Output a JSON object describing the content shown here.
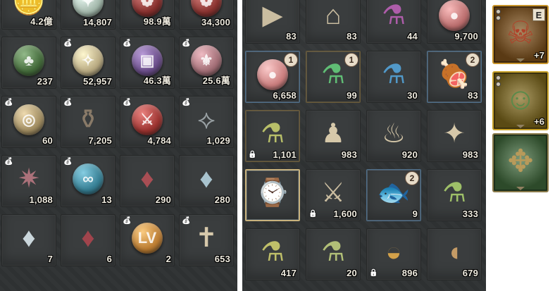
{
  "left_grid": {
    "items": [
      {
        "qty": "4.2億",
        "icon": "gold-coins-icon",
        "glyph": "🪙",
        "bag": true
      },
      {
        "qty": "14,807",
        "icon": "silver-seal-icon",
        "glyph": "✦",
        "color": "#9fb7a8",
        "bag": true
      },
      {
        "qty": "98.9萬",
        "icon": "red-seal-icon",
        "glyph": "❁",
        "color": "#8c2c2a",
        "bag": true
      },
      {
        "qty": "34,300",
        "icon": "red-seal-icon",
        "glyph": "❁",
        "color": "#8e2f2c",
        "bag": true
      },
      {
        "qty": "237",
        "icon": "green-tree-seal-icon",
        "glyph": "♣",
        "color": "#3f6a35",
        "bag": false
      },
      {
        "qty": "52,957",
        "icon": "bronze-seal-icon",
        "glyph": "✧",
        "color": "#b7a77b",
        "bag": true
      },
      {
        "qty": "46.3萬",
        "icon": "purple-seal-icon",
        "glyph": "▣",
        "color": "#6a4a8c",
        "bag": true
      },
      {
        "qty": "25.6萬",
        "icon": "pink-seal-icon",
        "glyph": "⚜",
        "color": "#a36a73",
        "bag": true
      },
      {
        "qty": "60",
        "icon": "bronze-medal-icon",
        "glyph": "◎",
        "color": "#a08a5a",
        "bag": true
      },
      {
        "qty": "7,205",
        "icon": "ornate-bottle-icon",
        "glyph": "⚱",
        "color": "#8a7a66",
        "bag": true
      },
      {
        "qty": "4,784",
        "icon": "crossed-swords-seal-icon",
        "glyph": "⚔",
        "color": "#a3302c",
        "bag": true
      },
      {
        "qty": "1,029",
        "icon": "silver-shards-icon",
        "glyph": "⟡",
        "color": "#9aa3a6",
        "bag": true
      },
      {
        "qty": "1,088",
        "icon": "pink-crystals-icon",
        "glyph": "✷",
        "color": "#b0707a",
        "bag": true
      },
      {
        "qty": "13",
        "icon": "infinity-seal-icon",
        "glyph": "∞",
        "color": "#2f7f96",
        "bag": true
      },
      {
        "qty": "290",
        "icon": "red-crystal-icon",
        "glyph": "♦",
        "color": "#b04c52",
        "bag": false
      },
      {
        "qty": "280",
        "icon": "blue-crystal-icon",
        "glyph": "♦",
        "color": "#a6c4d0",
        "bag": false
      },
      {
        "qty": "7",
        "icon": "clear-crystal-icon",
        "glyph": "♦",
        "color": "#c9d6dc",
        "bag": false
      },
      {
        "qty": "6",
        "icon": "red-crystal-icon",
        "glyph": "♦",
        "color": "#a8424b",
        "bag": false
      },
      {
        "qty": "2",
        "icon": "level-medal-icon",
        "glyph": "LV",
        "color": "#c07a28",
        "bag": true
      },
      {
        "qty": "653",
        "icon": "scroll-map-icon",
        "glyph": "✝",
        "color": "#d8c9a8",
        "bag": true
      }
    ]
  },
  "mid_grid": {
    "items": [
      {
        "qty": "83",
        "icon": "parchment-scroll-icon",
        "glyph": "▶",
        "color": "#cbbd9d",
        "style": "plain"
      },
      {
        "qty": "83",
        "icon": "parchment-bag-icon",
        "glyph": "⌂",
        "color": "#cbbd9d",
        "style": "plain"
      },
      {
        "qty": "44",
        "icon": "purple-potion-icon",
        "glyph": "⚗",
        "color": "#b45ab0",
        "style": "plain"
      },
      {
        "qty": "9,700",
        "icon": "red-orb-icon",
        "glyph": "●",
        "color": "#c06a6a",
        "style": "plain"
      },
      {
        "qty": "6,658",
        "icon": "meat-orb-icon",
        "glyph": "●",
        "color": "#d07a7a",
        "style": "blue",
        "badge": "1"
      },
      {
        "qty": "99",
        "icon": "green-potion-icon",
        "glyph": "⚗",
        "color": "#58c070",
        "style": "gold",
        "badge": "1"
      },
      {
        "qty": "30",
        "icon": "blue-potion-icon",
        "glyph": "⚗",
        "color": "#4a9ad0",
        "style": "plain"
      },
      {
        "qty": "83",
        "icon": "steak-plate-icon",
        "glyph": "🍖",
        "color": "#a8573a",
        "style": "blue",
        "badge": "2"
      },
      {
        "qty": "1,101",
        "icon": "yellow-potion-icon",
        "glyph": "⚗",
        "color": "#b8c060",
        "style": "gold",
        "lock": true
      },
      {
        "qty": "983",
        "icon": "scroll-figure-icon",
        "glyph": "♟",
        "color": "#d8c8a6",
        "style": "plain"
      },
      {
        "qty": "920",
        "icon": "scroll-flame-icon",
        "glyph": "♨",
        "color": "#d8c8a6",
        "style": "plain"
      },
      {
        "qty": "983",
        "icon": "scroll-spark-icon",
        "glyph": "✦",
        "color": "#d8c8a6",
        "style": "plain"
      },
      {
        "qty": "",
        "icon": "pocket-watch-icon",
        "glyph": "⌚",
        "color": "#6f86a8",
        "style": "selected"
      },
      {
        "qty": "1,600",
        "icon": "sword-parchment-icon",
        "glyph": "⚔",
        "color": "#cdbe9e",
        "style": "plain",
        "lock": true
      },
      {
        "qty": "9",
        "icon": "fish-plate-icon",
        "glyph": "🐟",
        "color": "#c98a6a",
        "style": "blue",
        "badge": "2"
      },
      {
        "qty": "333",
        "icon": "green-flask-icon",
        "glyph": "⚗",
        "color": "#9cc060",
        "style": "plain"
      },
      {
        "qty": "417",
        "icon": "yellow-flask-icon",
        "glyph": "⚗",
        "color": "#c0c060",
        "style": "plain"
      },
      {
        "qty": "20",
        "icon": "sparkle-potion-icon",
        "glyph": "⚗",
        "color": "#b0c070",
        "style": "plain"
      },
      {
        "qty": "896",
        "icon": "soup-bowl-icon",
        "glyph": "◒",
        "color": "#d8a040",
        "style": "plain",
        "lock": true
      },
      {
        "qty": "679",
        "icon": "bread-loaf-icon",
        "glyph": "◖",
        "color": "#c89a60",
        "style": "plain"
      }
    ]
  },
  "side_slots": [
    {
      "icon": "red-demon-mask-icon",
      "glyph": "☠",
      "grade": "E",
      "enhance": "+7",
      "bg": "#5a3a14",
      "frame": "#c8942a",
      "color": "#b04028"
    },
    {
      "icon": "jade-mask-icon",
      "glyph": "☺",
      "grade": "",
      "enhance": "+6",
      "bg": "#5a4a14",
      "frame": "#c8a22a",
      "color": "#5a8a4a"
    },
    {
      "icon": "green-emblem-icon",
      "glyph": "✥",
      "grade": "",
      "enhance": "",
      "bg": "#2d4a2a",
      "frame": "#8a7a4a",
      "color": "#b89a5a"
    }
  ]
}
